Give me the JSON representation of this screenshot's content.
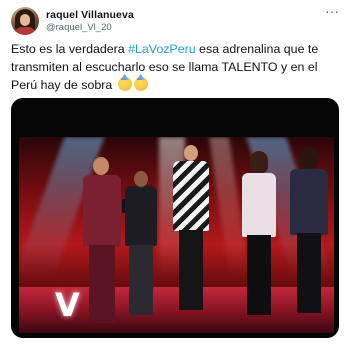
{
  "user": {
    "name": "raquel Villanueva",
    "handle": "@raquel_Vl_20"
  },
  "tweet": {
    "text_before": "Esto es la verdadera ",
    "hashtag": "#LaVozPeru",
    "text_after": " esa adrenalina que te transmiten al escucharlo eso se llama TALENTO y en el Perú hay de sobra",
    "emojis": [
      "party-face-emoji",
      "party-face-emoji"
    ]
  },
  "media": {
    "stage_logo": "V"
  },
  "icons": {
    "more": "more-options-icon"
  },
  "colors": {
    "link": "#1d9bf0",
    "text": "#0f1419",
    "secondary": "#536471"
  }
}
